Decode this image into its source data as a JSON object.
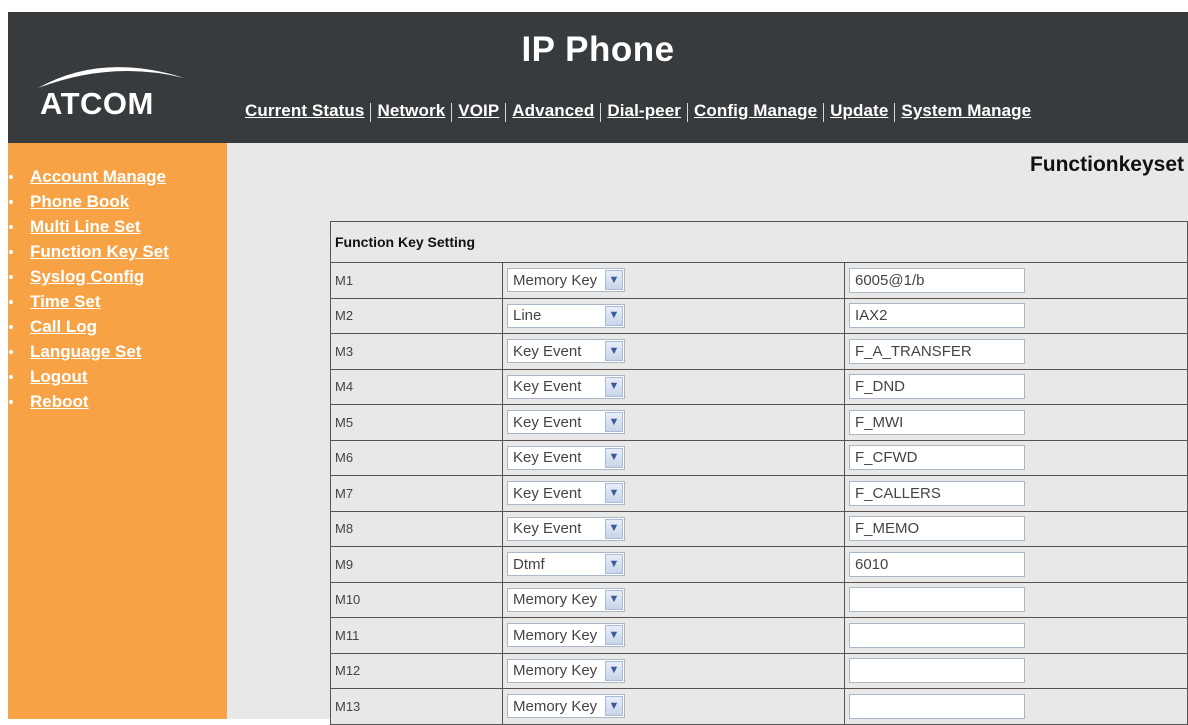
{
  "header": {
    "title": "IP Phone",
    "logo_text": "ATCOM"
  },
  "topnav": [
    {
      "label": "Current Status"
    },
    {
      "label": "Network"
    },
    {
      "label": "VOIP"
    },
    {
      "label": "Advanced"
    },
    {
      "label": "Dial-peer"
    },
    {
      "label": "Config Manage"
    },
    {
      "label": "Update"
    },
    {
      "label": "System Manage"
    }
  ],
  "sidebar": {
    "items": [
      {
        "label": "Account Manage"
      },
      {
        "label": "Phone Book"
      },
      {
        "label": "Multi Line Set"
      },
      {
        "label": "Function Key Set"
      },
      {
        "label": "Syslog Config"
      },
      {
        "label": "Time Set"
      },
      {
        "label": "Call Log"
      },
      {
        "label": "Language Set"
      },
      {
        "label": "Logout"
      },
      {
        "label": "Reboot"
      }
    ]
  },
  "main": {
    "heading": "Functionkeyset",
    "table_title": "Function Key Setting",
    "rows": [
      {
        "key": "M1",
        "type": "Memory Key",
        "value": "6005@1/b"
      },
      {
        "key": "M2",
        "type": "Line",
        "value": "IAX2"
      },
      {
        "key": "M3",
        "type": "Key Event",
        "value": "F_A_TRANSFER"
      },
      {
        "key": "M4",
        "type": "Key Event",
        "value": "F_DND"
      },
      {
        "key": "M5",
        "type": "Key Event",
        "value": "F_MWI"
      },
      {
        "key": "M6",
        "type": "Key Event",
        "value": "F_CFWD"
      },
      {
        "key": "M7",
        "type": "Key Event",
        "value": "F_CALLERS"
      },
      {
        "key": "M8",
        "type": "Key Event",
        "value": "F_MEMO"
      },
      {
        "key": "M9",
        "type": "Dtmf",
        "value": "6010"
      },
      {
        "key": "M10",
        "type": "Memory Key",
        "value": ""
      },
      {
        "key": "M11",
        "type": "Memory Key",
        "value": ""
      },
      {
        "key": "M12",
        "type": "Memory Key",
        "value": ""
      },
      {
        "key": "M13",
        "type": "Memory Key",
        "value": ""
      }
    ]
  },
  "colors": {
    "header_bg": "#383b3d",
    "sidebar_bg": "#f7a345",
    "content_bg": "#e8e8e8"
  }
}
